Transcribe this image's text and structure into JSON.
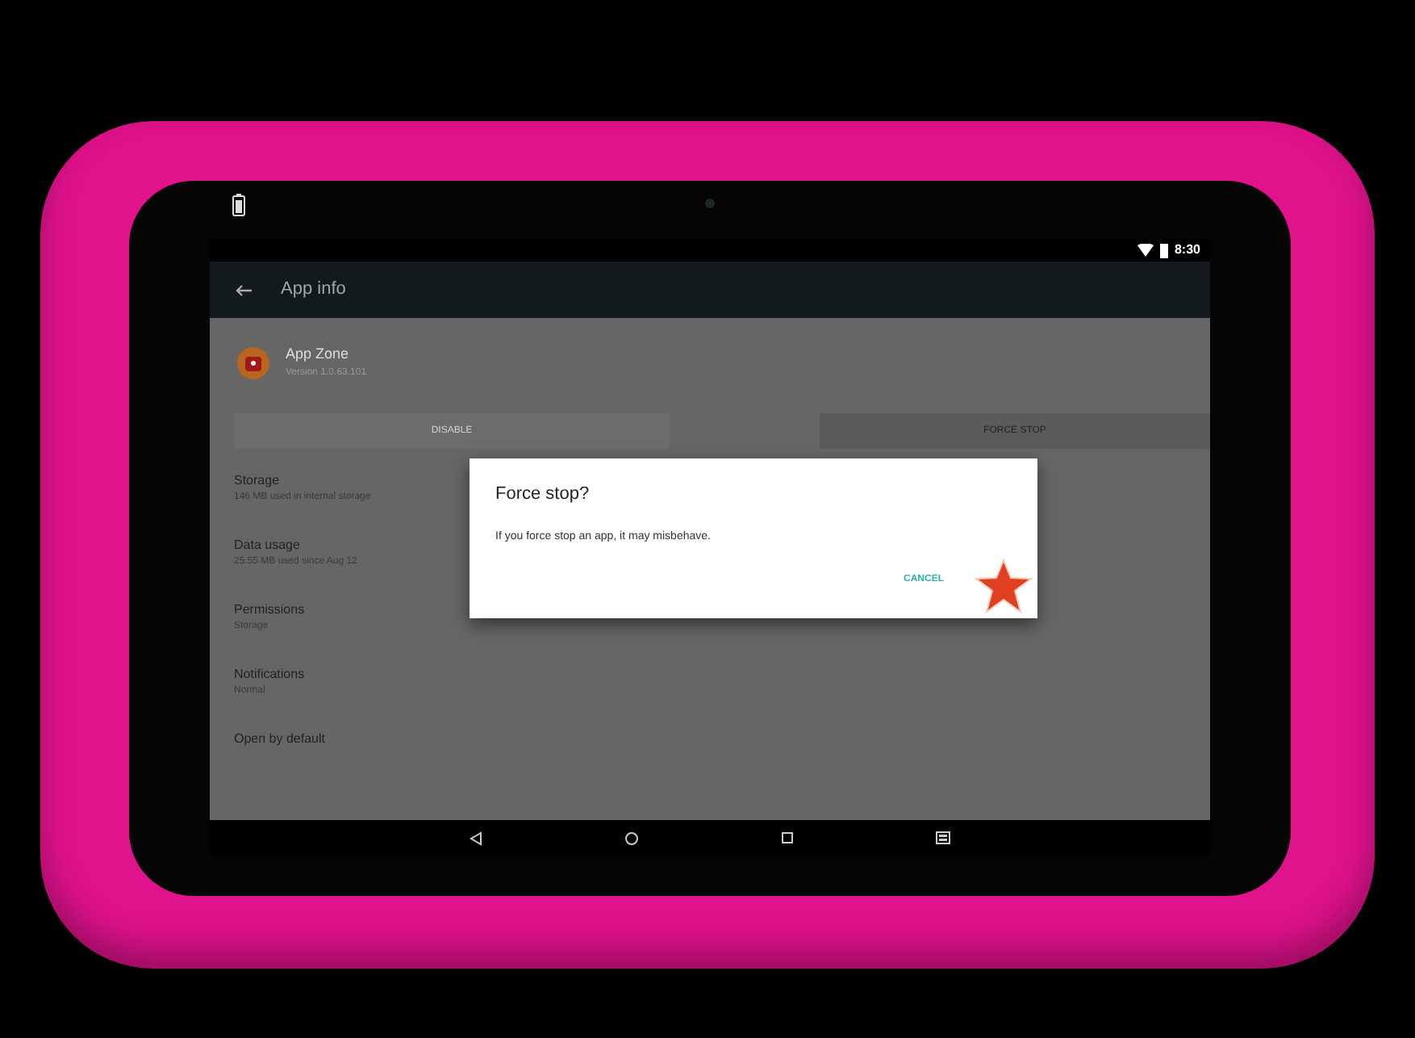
{
  "status_bar": {
    "time": "8:30"
  },
  "app_bar": {
    "title": "App info"
  },
  "app": {
    "name": "App Zone",
    "version": "Version 1.0.63.101"
  },
  "action_buttons": [
    {
      "label": "DISABLE",
      "disabled": true
    },
    {
      "label": "FORCE STOP",
      "disabled": false
    }
  ],
  "settings": [
    {
      "title": "Storage",
      "subtitle": "146 MB used in internal storage"
    },
    {
      "title": "Data usage",
      "subtitle": "25.55 MB used since Aug 12"
    },
    {
      "title": "Permissions",
      "subtitle": "Storage"
    },
    {
      "title": "Notifications",
      "subtitle": "Normal"
    },
    {
      "title": "Open by default"
    }
  ],
  "dialog": {
    "title": "Force stop?",
    "message": "If you force stop an app, it may misbehave.",
    "buttons": [
      "CANCEL"
    ]
  }
}
